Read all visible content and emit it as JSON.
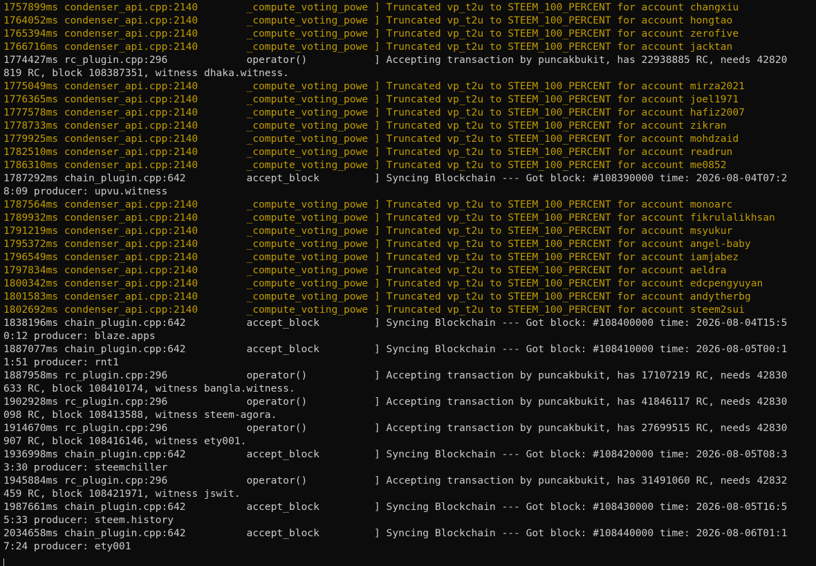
{
  "terminal": {
    "lines": [
      {
        "level": "warn",
        "text": "1757899ms condenser_api.cpp:2140        _compute_voting_powe ] Truncated vp_t2u to STEEM_100_PERCENT for account changxiu"
      },
      {
        "level": "warn",
        "text": "1764052ms condenser_api.cpp:2140        _compute_voting_powe ] Truncated vp_t2u to STEEM_100_PERCENT for account hongtao"
      },
      {
        "level": "warn",
        "text": "1765394ms condenser_api.cpp:2140        _compute_voting_powe ] Truncated vp_t2u to STEEM_100_PERCENT for account zerofive"
      },
      {
        "level": "warn",
        "text": "1766716ms condenser_api.cpp:2140        _compute_voting_powe ] Truncated vp_t2u to STEEM_100_PERCENT for account jacktan"
      },
      {
        "level": "info",
        "text": "1774427ms rc_plugin.cpp:296             operator()           ] Accepting transaction by puncakbukit, has 22938885 RC, needs 42820"
      },
      {
        "level": "info",
        "text": "819 RC, block 108387351, witness dhaka.witness."
      },
      {
        "level": "warn",
        "text": "1775049ms condenser_api.cpp:2140        _compute_voting_powe ] Truncated vp_t2u to STEEM_100_PERCENT for account mirza2021"
      },
      {
        "level": "warn",
        "text": "1776365ms condenser_api.cpp:2140        _compute_voting_powe ] Truncated vp_t2u to STEEM_100_PERCENT for account joel1971"
      },
      {
        "level": "warn",
        "text": "1777578ms condenser_api.cpp:2140        _compute_voting_powe ] Truncated vp_t2u to STEEM_100_PERCENT for account hafiz2007"
      },
      {
        "level": "warn",
        "text": "1778733ms condenser_api.cpp:2140        _compute_voting_powe ] Truncated vp_t2u to STEEM_100_PERCENT for account zikran"
      },
      {
        "level": "warn",
        "text": "1779925ms condenser_api.cpp:2140        _compute_voting_powe ] Truncated vp_t2u to STEEM_100_PERCENT for account mohdzaid"
      },
      {
        "level": "warn",
        "text": "1782510ms condenser_api.cpp:2140        _compute_voting_powe ] Truncated vp_t2u to STEEM_100_PERCENT for account readrun"
      },
      {
        "level": "warn",
        "text": "1786310ms condenser_api.cpp:2140        _compute_voting_powe ] Truncated vp_t2u to STEEM_100_PERCENT for account me0852"
      },
      {
        "level": "info",
        "text": "1787292ms chain_plugin.cpp:642          accept_block         ] Syncing Blockchain --- Got block: #108390000 time: 2026-08-04T07:2"
      },
      {
        "level": "info",
        "text": "8:09 producer: upvu.witness"
      },
      {
        "level": "warn",
        "text": "1787564ms condenser_api.cpp:2140        _compute_voting_powe ] Truncated vp_t2u to STEEM_100_PERCENT for account monoarc"
      },
      {
        "level": "warn",
        "text": "1789932ms condenser_api.cpp:2140        _compute_voting_powe ] Truncated vp_t2u to STEEM_100_PERCENT for account fikrulalikhsan"
      },
      {
        "level": "warn",
        "text": "1791219ms condenser_api.cpp:2140        _compute_voting_powe ] Truncated vp_t2u to STEEM_100_PERCENT for account msyukur"
      },
      {
        "level": "warn",
        "text": "1795372ms condenser_api.cpp:2140        _compute_voting_powe ] Truncated vp_t2u to STEEM_100_PERCENT for account angel-baby"
      },
      {
        "level": "warn",
        "text": "1796549ms condenser_api.cpp:2140        _compute_voting_powe ] Truncated vp_t2u to STEEM_100_PERCENT for account iamjabez"
      },
      {
        "level": "warn",
        "text": "1797834ms condenser_api.cpp:2140        _compute_voting_powe ] Truncated vp_t2u to STEEM_100_PERCENT for account aeldra"
      },
      {
        "level": "warn",
        "text": "1800342ms condenser_api.cpp:2140        _compute_voting_powe ] Truncated vp_t2u to STEEM_100_PERCENT for account edcpengyuyan"
      },
      {
        "level": "warn",
        "text": "1801583ms condenser_api.cpp:2140        _compute_voting_powe ] Truncated vp_t2u to STEEM_100_PERCENT for account andytherbg"
      },
      {
        "level": "warn",
        "text": "1802692ms condenser_api.cpp:2140        _compute_voting_powe ] Truncated vp_t2u to STEEM_100_PERCENT for account steem2sui"
      },
      {
        "level": "info",
        "text": "1838196ms chain_plugin.cpp:642          accept_block         ] Syncing Blockchain --- Got block: #108400000 time: 2026-08-04T15:5"
      },
      {
        "level": "info",
        "text": "0:12 producer: blaze.apps"
      },
      {
        "level": "info",
        "text": "1887077ms chain_plugin.cpp:642          accept_block         ] Syncing Blockchain --- Got block: #108410000 time: 2026-08-05T00:1"
      },
      {
        "level": "info",
        "text": "1:51 producer: rnt1"
      },
      {
        "level": "info",
        "text": "1887958ms rc_plugin.cpp:296             operator()           ] Accepting transaction by puncakbukit, has 17107219 RC, needs 42830"
      },
      {
        "level": "info",
        "text": "633 RC, block 108410174, witness bangla.witness."
      },
      {
        "level": "info",
        "text": "1902928ms rc_plugin.cpp:296             operator()           ] Accepting transaction by puncakbukit, has 41846117 RC, needs 42830"
      },
      {
        "level": "info",
        "text": "098 RC, block 108413588, witness steem-agora."
      },
      {
        "level": "info",
        "text": "1914670ms rc_plugin.cpp:296             operator()           ] Accepting transaction by puncakbukit, has 27699515 RC, needs 42830"
      },
      {
        "level": "info",
        "text": "907 RC, block 108416146, witness ety001."
      },
      {
        "level": "info",
        "text": "1936998ms chain_plugin.cpp:642          accept_block         ] Syncing Blockchain --- Got block: #108420000 time: 2026-08-05T08:3"
      },
      {
        "level": "info",
        "text": "3:30 producer: steemchiller"
      },
      {
        "level": "info",
        "text": "1945884ms rc_plugin.cpp:296             operator()           ] Accepting transaction by puncakbukit, has 31491060 RC, needs 42832"
      },
      {
        "level": "info",
        "text": "459 RC, block 108421971, witness jswit."
      },
      {
        "level": "info",
        "text": "1987661ms chain_plugin.cpp:642          accept_block         ] Syncing Blockchain --- Got block: #108430000 time: 2026-08-05T16:5"
      },
      {
        "level": "info",
        "text": "5:33 producer: steem.history"
      },
      {
        "level": "info",
        "text": "2034658ms chain_plugin.cpp:642          accept_block         ] Syncing Blockchain --- Got block: #108440000 time: 2026-08-06T01:1"
      },
      {
        "level": "info",
        "text": "7:24 producer: ety001"
      }
    ]
  },
  "colors": {
    "background": "#0c0c0c",
    "info_text": "#cccccc",
    "warning_text": "#c19c00"
  }
}
